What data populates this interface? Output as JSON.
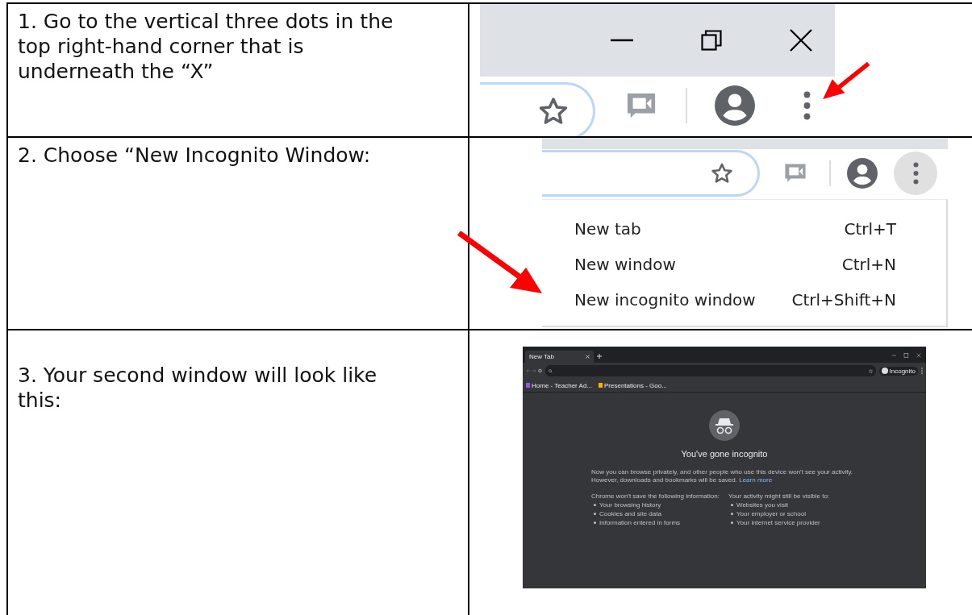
{
  "steps": [
    {
      "kind": "controls",
      "instruction": "1. Go to the vertical three dots in the top right-hand corner that is underneath the “X”"
    },
    {
      "kind": "menu",
      "instruction": "2. Choose “New Incognito Window:",
      "menu_items": [
        {
          "label": "New tab",
          "shortcut": "Ctrl+T"
        },
        {
          "label": "New window",
          "shortcut": "Ctrl+N"
        },
        {
          "label": "New incognito window",
          "shortcut": "Ctrl+Shift+N"
        }
      ]
    },
    {
      "kind": "screenshot",
      "instruction": "3. Your second window will look like this:",
      "window": {
        "tab_title": "New Tab",
        "profile_label": "Incognito",
        "bookmarks": [
          "Home - Teacher Ad...",
          "Presentations - Goo..."
        ],
        "heading": "You've gone incognito",
        "intro": "Now you can browse privately, and other people who use this device won't see your activity. However, downloads and bookmarks will be saved.",
        "intro_link": "Learn more",
        "left_heading": "Chrome won't save the following information:",
        "left_items": [
          "Your browsing history",
          "Cookies and site data",
          "Information entered in forms"
        ],
        "right_heading": "Your activity might still be visible to:",
        "right_items": [
          "Websites you visit",
          "Your employer or school",
          "Your internet service provider"
        ]
      }
    }
  ]
}
